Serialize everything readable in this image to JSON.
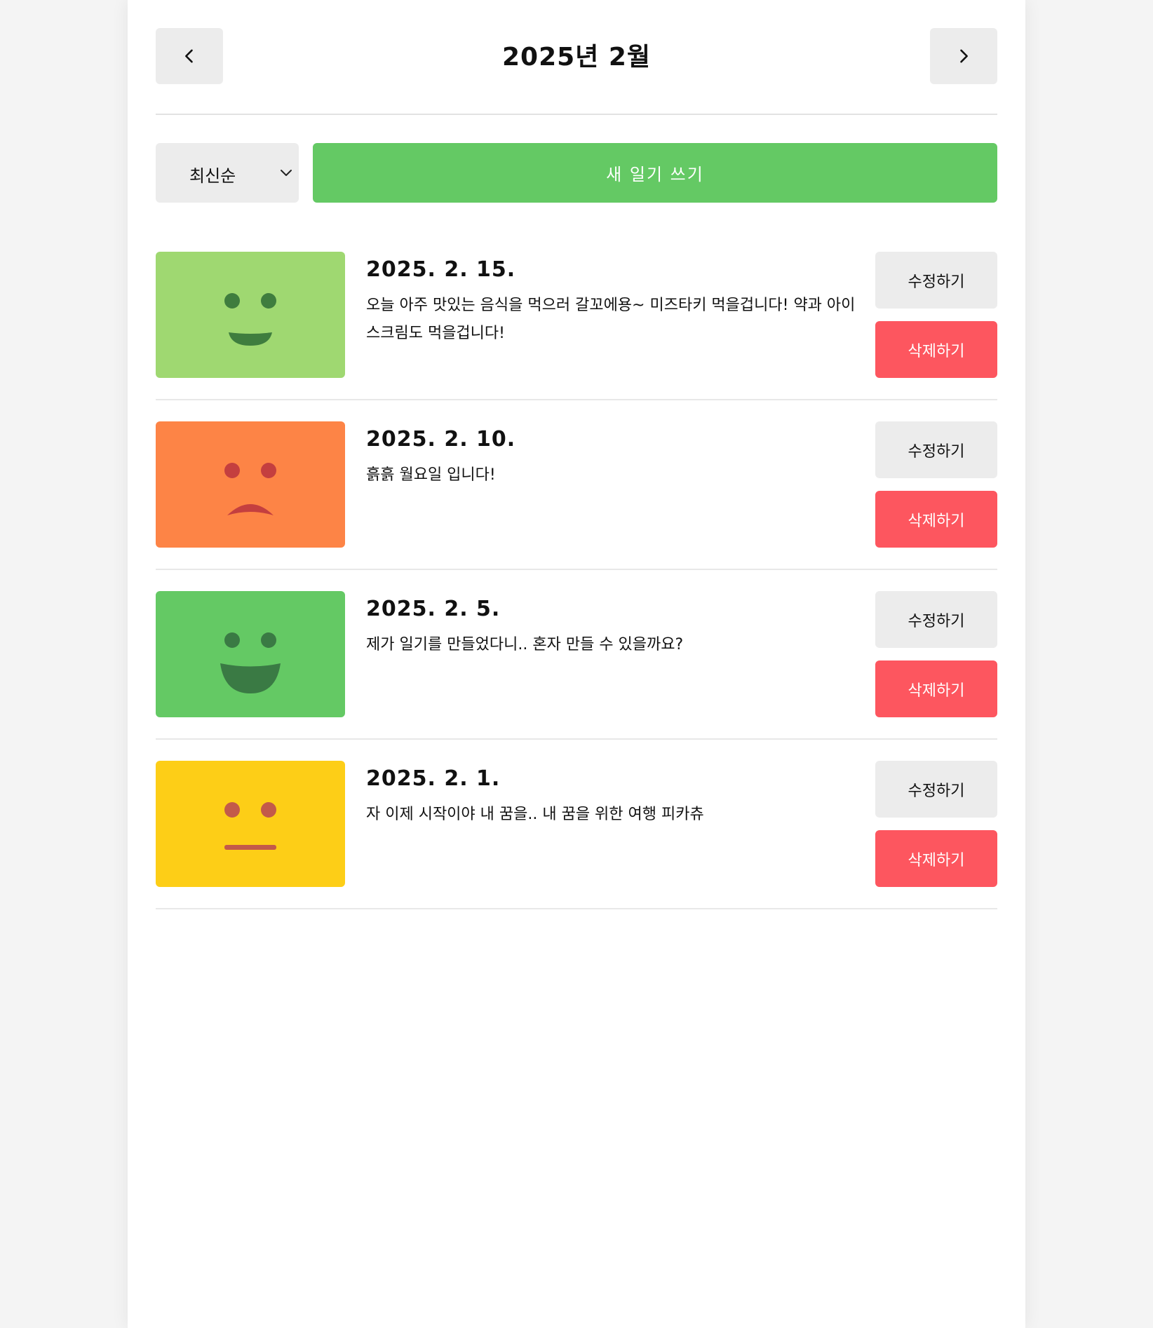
{
  "header": {
    "title": "2025년 2월",
    "prev_icon": "chevron-left-icon",
    "next_icon": "chevron-right-icon"
  },
  "controls": {
    "sort_selected": "최신순",
    "new_button": "새 일기 쓰기"
  },
  "colors": {
    "accent_green": "#64c964",
    "delete_red": "#fd565f",
    "button_gray": "#ececec"
  },
  "diary": [
    {
      "date": "2025. 2. 15.",
      "content": "오늘 아주 맛있는 음식을 먹으러 갈꼬에용~ 미즈타키 먹을겁니다! 약과 아이스크림도 먹을겁니다!",
      "emotion": "good",
      "color": "#9fd871",
      "edit": "수정하기",
      "delete": "삭제하기"
    },
    {
      "date": "2025. 2. 10.",
      "content": "흙흙 월요일 입니다!",
      "emotion": "bad",
      "color": "#fd8446",
      "edit": "수정하기",
      "delete": "삭제하기"
    },
    {
      "date": "2025. 2. 5.",
      "content": "제가 일기를 만들었다니.. 혼자 만들 수 있을까요?",
      "emotion": "great",
      "color": "#64c964",
      "edit": "수정하기",
      "delete": "삭제하기"
    },
    {
      "date": "2025. 2. 1.",
      "content": "자 이제 시작이야 내 꿈을.. 내 꿈을 위한 여행 피카츄",
      "emotion": "so-so",
      "color": "#fdce17",
      "edit": "수정하기",
      "delete": "삭제하기"
    }
  ]
}
